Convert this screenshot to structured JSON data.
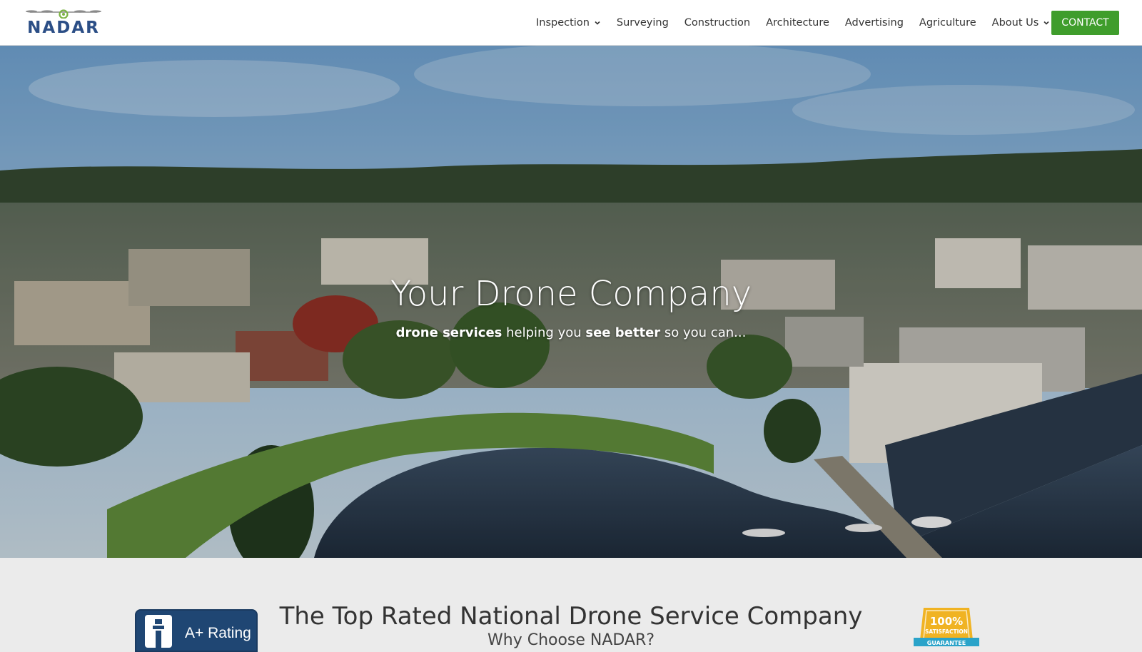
{
  "header": {
    "logo_text": "NADAR",
    "nav": [
      {
        "label": "Inspection",
        "has_dropdown": true
      },
      {
        "label": "Surveying",
        "has_dropdown": false
      },
      {
        "label": "Construction",
        "has_dropdown": false
      },
      {
        "label": "Architecture",
        "has_dropdown": false
      },
      {
        "label": "Advertising",
        "has_dropdown": false
      },
      {
        "label": "Agriculture",
        "has_dropdown": false
      },
      {
        "label": "About Us",
        "has_dropdown": true
      }
    ],
    "contact_label": "CONTACT"
  },
  "hero": {
    "title": "Your Drone Company",
    "subtitle": {
      "part1_bold": "drone services",
      "part2": " helping you ",
      "part3_bold": "see better",
      "part4": " so you can..."
    }
  },
  "lower": {
    "bbb_rating": "A+ Rating",
    "title": "The Top Rated National Drone Service Company",
    "subtitle": "Why Choose NADAR?",
    "badge_percent": "100%",
    "badge_label": "SATISFACTION",
    "badge_ribbon": "GUARANTEE"
  },
  "colors": {
    "brand_blue": "#2b4e86",
    "contact_green": "#3f9d2c",
    "bbb_blue": "#1f4673",
    "badge_gold": "#f0b323"
  },
  "icons": [
    "drone-logo-icon",
    "chevron-down-icon",
    "bbb-torch-icon",
    "satisfaction-badge-icon"
  ]
}
